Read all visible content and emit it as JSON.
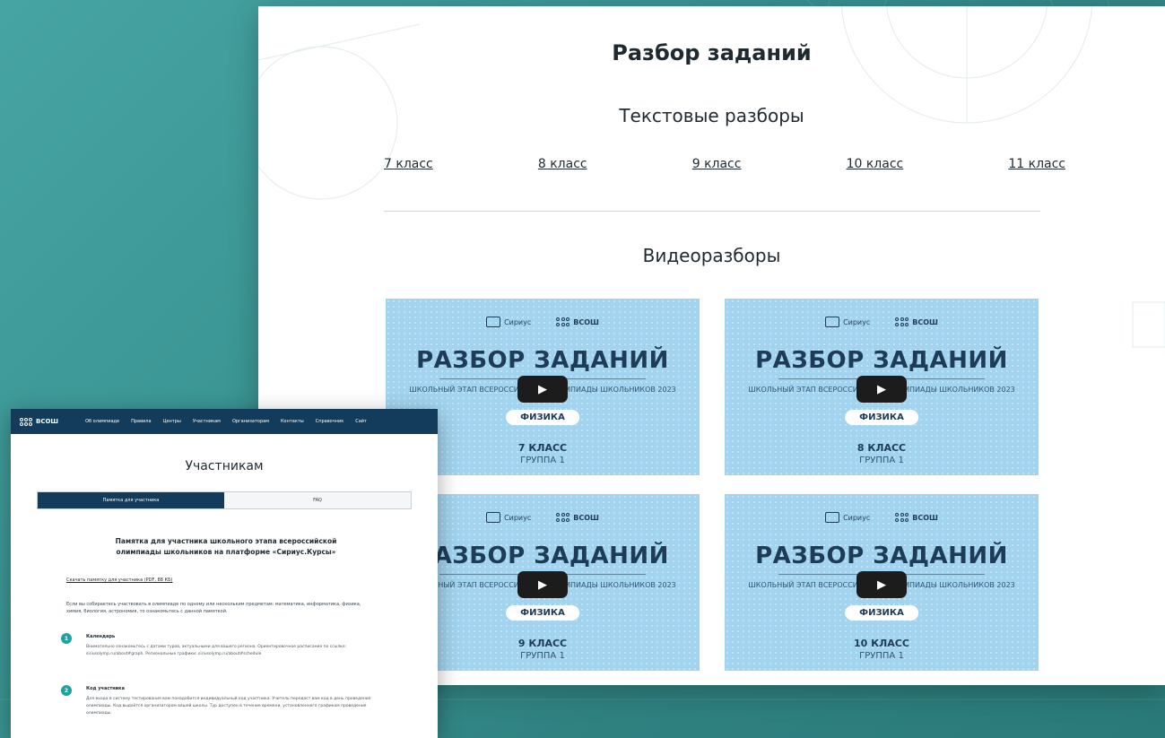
{
  "main": {
    "title": "Разбор заданий",
    "text_section_title": "Текстовые разборы",
    "class_links": [
      "7 класс",
      "8 класс",
      "9 класс",
      "10 класс",
      "11 класс"
    ],
    "video_section_title": "Видеоразборы",
    "videos": [
      {
        "heading": "РАЗБОР ЗАДАНИЙ",
        "sub": "ШКОЛЬНЫЙ ЭТАП ВСЕРОССИЙСКОЙ ОЛИМПИАДЫ ШКОЛЬНИКОВ 2023",
        "subject": "ФИЗИКА",
        "grade": "7 КЛАСС",
        "group": "ГРУППА 1"
      },
      {
        "heading": "РАЗБОР ЗАДАНИЙ",
        "sub": "ШКОЛЬНЫЙ ЭТАП ВСЕРОССИЙСКОЙ ОЛИМПИАДЫ ШКОЛЬНИКОВ 2023",
        "subject": "ФИЗИКА",
        "grade": "8 КЛАСС",
        "group": "ГРУППА 1"
      },
      {
        "heading": "РАЗБОР ЗАДАНИЙ",
        "sub": "ШКОЛЬНЫЙ ЭТАП ВСЕРОССИЙСКОЙ ОЛИМПИАДЫ ШКОЛЬНИКОВ 2023",
        "subject": "ФИЗИКА",
        "grade": "9 КЛАСС",
        "group": "ГРУППА 1"
      },
      {
        "heading": "РАЗБОР ЗАДАНИЙ",
        "sub": "ШКОЛЬНЫЙ ЭТАП ВСЕРОССИЙСКОЙ ОЛИМПИАДЫ ШКОЛЬНИКОВ 2023",
        "subject": "ФИЗИКА",
        "grade": "10 КЛАСС",
        "group": "ГРУППА 1"
      }
    ],
    "video_logo_left": "Сириус",
    "video_logo_right": "ВСОШ"
  },
  "participants": {
    "nav_logo": "ВСОШ",
    "nav_items": [
      "Об олимпиаде",
      "Правила",
      "Центры",
      "Участникам",
      "Организаторам",
      "Контакты",
      "Справочник",
      "Сайт"
    ],
    "title": "Участникам",
    "tabs": [
      "Памятка для участника",
      "FAQ"
    ],
    "heading": "Памятка для участника школьного этапа всероссийской олимпиады школьников на платформе «Сириус.Курсы»",
    "link": "Скачать памятку для участника (PDF, 88 КБ)",
    "intro": "Если вы собираетесь участвовать в олимпиаде по одному или нескольким предметам: математика, информатика, физика, химия, биология, астрономия, то ознакомьтесь с данной памяткой.",
    "steps": [
      {
        "num": "1",
        "title": "Календарь",
        "text": "Внимательно ознакомьтесь с датами туров, актуальными для вашего региона. Ориентировочное расписание по ссылке: siriusolymp.ru/about#graph. Региональные графики: siriusolymp.ru/about#schedule"
      },
      {
        "num": "2",
        "title": "Код участника",
        "text": "Для входа в систему тестирования вам понадобится индивидуальный код участника. Учитель передаст вам код в день проведения олимпиады. Код выдаётся организатором вашей школы. Тур доступен в течение времени, установленного графиком проведения олимпиады."
      }
    ]
  }
}
